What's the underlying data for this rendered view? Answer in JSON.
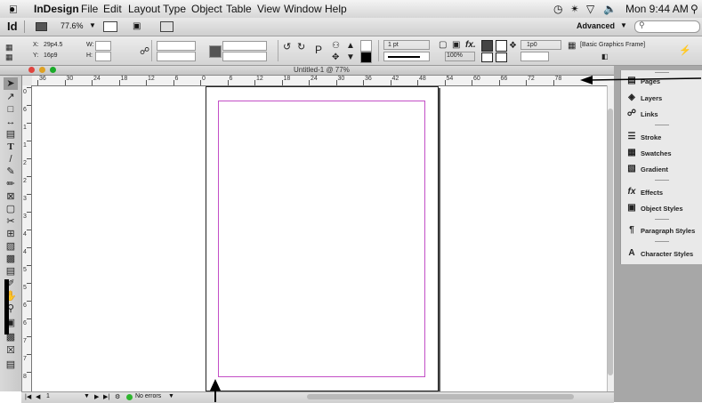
{
  "menubar": {
    "apple": "",
    "app_name": "InDesign",
    "menus": [
      "File",
      "Edit",
      "Layout",
      "Type",
      "Object",
      "Table",
      "View",
      "Window",
      "Help"
    ],
    "clock": "Mon 9:44 AM"
  },
  "appbar": {
    "logo": "Id",
    "zoom": "77.6%",
    "workspace": "Advanced"
  },
  "control": {
    "x_label": "X:",
    "x_value": "29p4.5",
    "y_label": "Y:",
    "y_value": "16p9",
    "w_label": "W:",
    "h_label": "H:",
    "stroke_weight": "1 pt",
    "opacity": "100%",
    "fx_label": "fx.",
    "offset_value": "1p0",
    "frame_style": "[Basic Graphics Frame]"
  },
  "document": {
    "title": "Untitled-1 @ 77%"
  },
  "ruler": {
    "h_ticks": [
      "36",
      "30",
      "24",
      "18",
      "12",
      "6",
      "0",
      "6",
      "12",
      "18",
      "24",
      "30",
      "36",
      "42",
      "48",
      "54",
      "60",
      "66",
      "72",
      "78"
    ],
    "v_ticks": [
      "0",
      "6",
      "1",
      "1",
      "2",
      "2",
      "3",
      "3",
      "4",
      "4",
      "5",
      "5",
      "6",
      "6",
      "7",
      "7",
      "8"
    ]
  },
  "statusbar": {
    "page": "1",
    "errors": "No errors"
  },
  "panels": [
    {
      "label": "Pages",
      "icon": "pages-icon"
    },
    {
      "label": "Layers",
      "icon": "layers-icon"
    },
    {
      "label": "Links",
      "icon": "links-icon"
    },
    {
      "label": "Stroke",
      "icon": "stroke-icon"
    },
    {
      "label": "Swatches",
      "icon": "swatches-icon"
    },
    {
      "label": "Gradient",
      "icon": "gradient-icon"
    },
    {
      "label": "Effects",
      "icon": "effects-icon"
    },
    {
      "label": "Object Styles",
      "icon": "object-styles-icon"
    },
    {
      "label": "Paragraph Styles",
      "icon": "paragraph-styles-icon"
    },
    {
      "label": "Character Styles",
      "icon": "character-styles-icon"
    }
  ],
  "colors": {
    "margin_guide": "#c34fc6",
    "status_ok": "#2fb52f"
  }
}
